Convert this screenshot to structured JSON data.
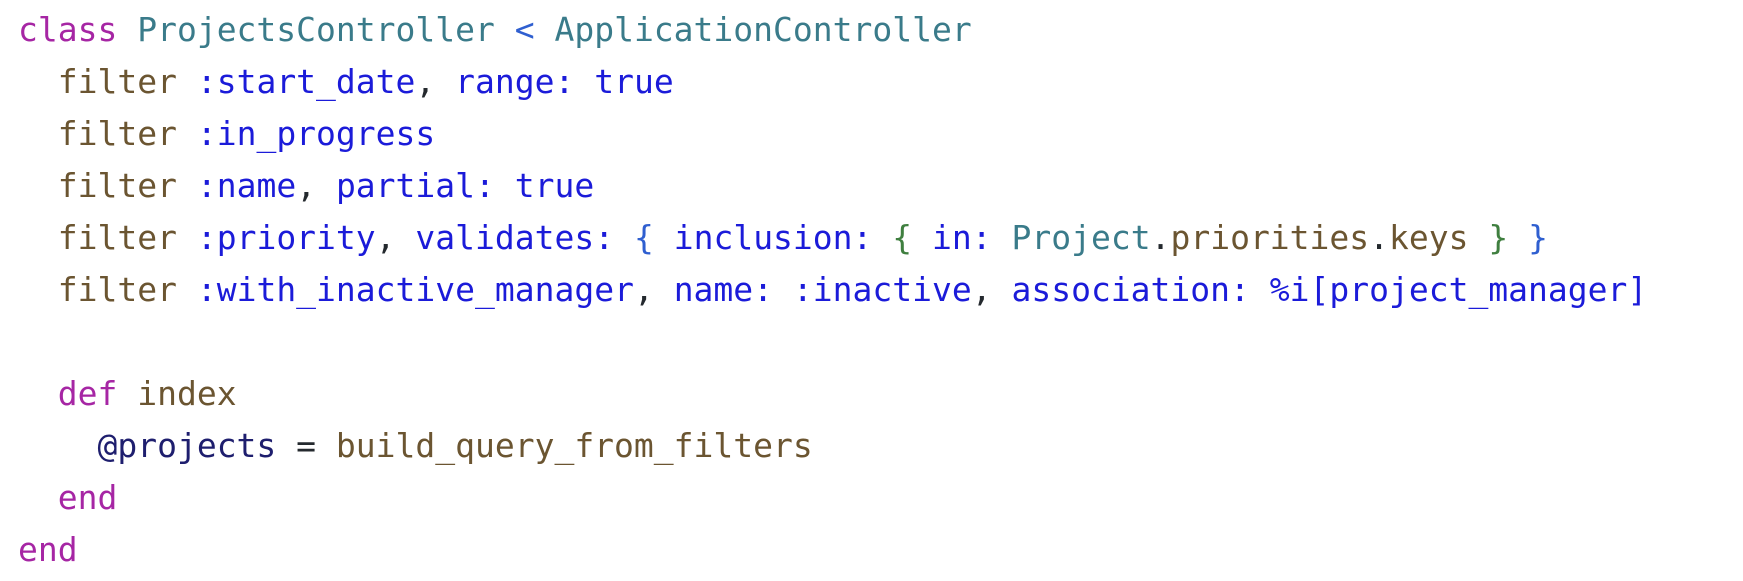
{
  "colors": {
    "background": "#ffffff",
    "keyword": "#a626a4",
    "constant": "#3a7b8a",
    "method": "#6b5531",
    "symbol": "#1b1bd9",
    "operator": "#2f5fd0",
    "brace_inner": "#3f7f3f",
    "ivar": "#1e1e6e",
    "plain": "#24292e"
  },
  "code": {
    "lines": [
      {
        "tokens": [
          {
            "text": "class",
            "kind": "keyword"
          },
          {
            "text": " ",
            "kind": "plain"
          },
          {
            "text": "ProjectsController",
            "kind": "constant"
          },
          {
            "text": " ",
            "kind": "plain"
          },
          {
            "text": "<",
            "kind": "operator"
          },
          {
            "text": " ",
            "kind": "plain"
          },
          {
            "text": "ApplicationController",
            "kind": "constant"
          }
        ]
      },
      {
        "tokens": [
          {
            "text": "  ",
            "kind": "plain"
          },
          {
            "text": "filter",
            "kind": "method"
          },
          {
            "text": " ",
            "kind": "plain"
          },
          {
            "text": ":start_date",
            "kind": "symbol"
          },
          {
            "text": ", ",
            "kind": "plain"
          },
          {
            "text": "range:",
            "kind": "symbol"
          },
          {
            "text": " ",
            "kind": "plain"
          },
          {
            "text": "true",
            "kind": "symbol"
          }
        ]
      },
      {
        "tokens": [
          {
            "text": "  ",
            "kind": "plain"
          },
          {
            "text": "filter",
            "kind": "method"
          },
          {
            "text": " ",
            "kind": "plain"
          },
          {
            "text": ":in_progress",
            "kind": "symbol"
          }
        ]
      },
      {
        "tokens": [
          {
            "text": "  ",
            "kind": "plain"
          },
          {
            "text": "filter",
            "kind": "method"
          },
          {
            "text": " ",
            "kind": "plain"
          },
          {
            "text": ":name",
            "kind": "symbol"
          },
          {
            "text": ", ",
            "kind": "plain"
          },
          {
            "text": "partial:",
            "kind": "symbol"
          },
          {
            "text": " ",
            "kind": "plain"
          },
          {
            "text": "true",
            "kind": "symbol"
          }
        ]
      },
      {
        "tokens": [
          {
            "text": "  ",
            "kind": "plain"
          },
          {
            "text": "filter",
            "kind": "method"
          },
          {
            "text": " ",
            "kind": "plain"
          },
          {
            "text": ":priority",
            "kind": "symbol"
          },
          {
            "text": ", ",
            "kind": "plain"
          },
          {
            "text": "validates:",
            "kind": "symbol"
          },
          {
            "text": " ",
            "kind": "plain"
          },
          {
            "text": "{",
            "kind": "operator"
          },
          {
            "text": " ",
            "kind": "plain"
          },
          {
            "text": "inclusion:",
            "kind": "symbol"
          },
          {
            "text": " ",
            "kind": "plain"
          },
          {
            "text": "{",
            "kind": "brace_inner"
          },
          {
            "text": " ",
            "kind": "plain"
          },
          {
            "text": "in:",
            "kind": "symbol"
          },
          {
            "text": " ",
            "kind": "plain"
          },
          {
            "text": "Project",
            "kind": "constant"
          },
          {
            "text": ".",
            "kind": "plain"
          },
          {
            "text": "priorities",
            "kind": "method"
          },
          {
            "text": ".",
            "kind": "plain"
          },
          {
            "text": "keys",
            "kind": "method"
          },
          {
            "text": " ",
            "kind": "plain"
          },
          {
            "text": "}",
            "kind": "brace_inner"
          },
          {
            "text": " ",
            "kind": "plain"
          },
          {
            "text": "}",
            "kind": "operator"
          }
        ]
      },
      {
        "tokens": [
          {
            "text": "  ",
            "kind": "plain"
          },
          {
            "text": "filter",
            "kind": "method"
          },
          {
            "text": " ",
            "kind": "plain"
          },
          {
            "text": ":with_inactive_manager",
            "kind": "symbol"
          },
          {
            "text": ", ",
            "kind": "plain"
          },
          {
            "text": "name:",
            "kind": "symbol"
          },
          {
            "text": " ",
            "kind": "plain"
          },
          {
            "text": ":inactive",
            "kind": "symbol"
          },
          {
            "text": ", ",
            "kind": "plain"
          },
          {
            "text": "association:",
            "kind": "symbol"
          },
          {
            "text": " ",
            "kind": "plain"
          },
          {
            "text": "%i[project_manager]",
            "kind": "symbol"
          }
        ]
      },
      {
        "tokens": []
      },
      {
        "tokens": [
          {
            "text": "  ",
            "kind": "plain"
          },
          {
            "text": "def",
            "kind": "keyword"
          },
          {
            "text": " ",
            "kind": "plain"
          },
          {
            "text": "index",
            "kind": "method"
          }
        ]
      },
      {
        "tokens": [
          {
            "text": "    ",
            "kind": "plain"
          },
          {
            "text": "@projects",
            "kind": "ivar"
          },
          {
            "text": " = ",
            "kind": "plain"
          },
          {
            "text": "build_query_from_filters",
            "kind": "method"
          }
        ]
      },
      {
        "tokens": [
          {
            "text": "  ",
            "kind": "plain"
          },
          {
            "text": "end",
            "kind": "keyword"
          }
        ]
      },
      {
        "tokens": [
          {
            "text": "end",
            "kind": "keyword"
          }
        ]
      }
    ]
  }
}
